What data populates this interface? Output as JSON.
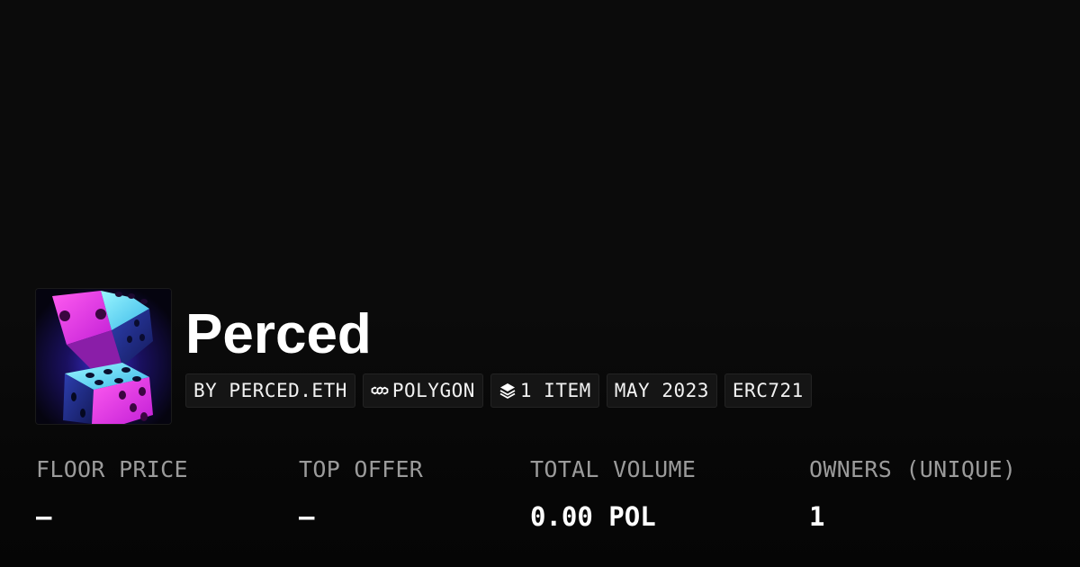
{
  "collection": {
    "name": "Perced",
    "image_alt": "two neon dice"
  },
  "tags": {
    "creator": "BY PERCED.ETH",
    "chain": "POLYGON",
    "chain_icon": "polygon-icon",
    "items": "1 ITEM",
    "items_icon": "layers-icon",
    "date": "MAY 2023",
    "standard": "ERC721"
  },
  "stats": [
    {
      "label": "FLOOR PRICE",
      "value": "–"
    },
    {
      "label": "TOP OFFER",
      "value": "–"
    },
    {
      "label": "TOTAL VOLUME",
      "value": "0.00 POL"
    },
    {
      "label": "OWNERS (UNIQUE)",
      "value": "1"
    }
  ],
  "colors": {
    "background": "#0b0b0b",
    "tag_background": "#151515",
    "label": "#9b9b9b",
    "text": "#ffffff"
  }
}
